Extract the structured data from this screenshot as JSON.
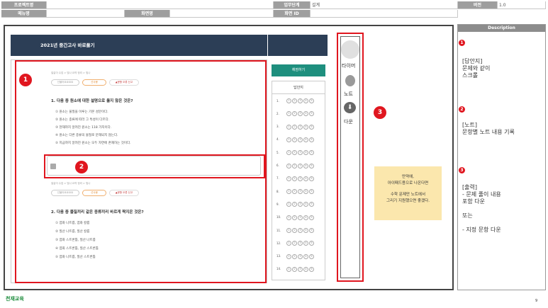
{
  "header": {
    "project_label": "프로젝트명",
    "project_value": "",
    "menu_label": "메뉴명",
    "menu_value": "",
    "screen_name_label": "화면명",
    "screen_name_value": "",
    "stage_label": "업무단계",
    "stage_value": "설계",
    "screen_id_label": "화면 ID",
    "screen_id_value": "",
    "version_label": "버전",
    "version_value": "1.0"
  },
  "banner_title": "2021년 중간고사 바로풀기",
  "question1": {
    "crumb": "질갈이 수업  >  빛나 요약 정리  >  빛나",
    "pill_a": "선물어요요요요",
    "pill_b": "선사봉",
    "pill_c": "문항 오류 신고",
    "text": "1. 다음 중 원소에 대한 설명으로 옳지 않은 것은?",
    "options": [
      "① 원소는 물질을 이루는 기본 성분이다.",
      "② 원소는 종류에 따라 그 특성이 다르다.",
      "③ 현재까지 알려진 원소는 118 가지이다.",
      "④ 원소는 다른 종류의 물질로 분해되지 않는다.",
      "⑤ 지금까지 알려진 원소는 모두 자연에 존재하는 것이다."
    ]
  },
  "question2": {
    "crumb": "질갈이 수업  >  빛나 요약 정리  >  빛나",
    "pill_a": "선물어요요요요",
    "pill_b": "선사봉",
    "pill_c": "문항 오류 신고",
    "text": "2. 다음 중 물질끼리 같은 종류끼리 바르게 짝지은 것은?",
    "options": [
      "① 염화 나트륨, 염화 칼륨",
      "② 질산 나트륨, 질산 칼륨",
      "③ 염화 스트론튬, 질산 나트륨",
      "④ 염화 스트론튬, 질산 스트론튬",
      "⑤ 염화 나트륨, 질산 스트론튬"
    ]
  },
  "grade_button": "채점하기",
  "answer_sheet": {
    "title": "답안지",
    "rows": [
      "1.",
      "2.",
      "3.",
      "4.",
      "5.",
      "6.",
      "7.",
      "8.",
      "9.",
      "10.",
      "11.",
      "12.",
      "13.",
      "14."
    ],
    "choices": [
      "1",
      "2",
      "3",
      "4",
      "5"
    ]
  },
  "toolbar": {
    "timer_label": "타이머",
    "note_label": "노트",
    "download_label": "다운"
  },
  "sticky_note": [
    "만약에,",
    "아이패드용으로 나온다면",
    "",
    "수학 문제만 노트에서",
    "그리기 지원했으면 좋겠다."
  ],
  "markers": {
    "one": "1",
    "two": "2",
    "three": "3"
  },
  "description": {
    "title": "Description",
    "item1": [
      "[답안지]",
      "문제와 같이",
      "스크롤"
    ],
    "item2": [
      "[노트]",
      "문항별 노트 내용 기록"
    ],
    "item3": [
      "[출력]",
      "- 문제 풀이 내용",
      "포함 다운",
      "",
      "또는",
      "",
      "- 지정 문항 다운"
    ]
  },
  "footer": {
    "logo": "천재교육",
    "page": "9"
  },
  "colors": {
    "banner": "#2c3e56",
    "marker_red": "#e0161f",
    "grade_green": "#1e8f7e",
    "sticky": "#fbe7ad"
  }
}
